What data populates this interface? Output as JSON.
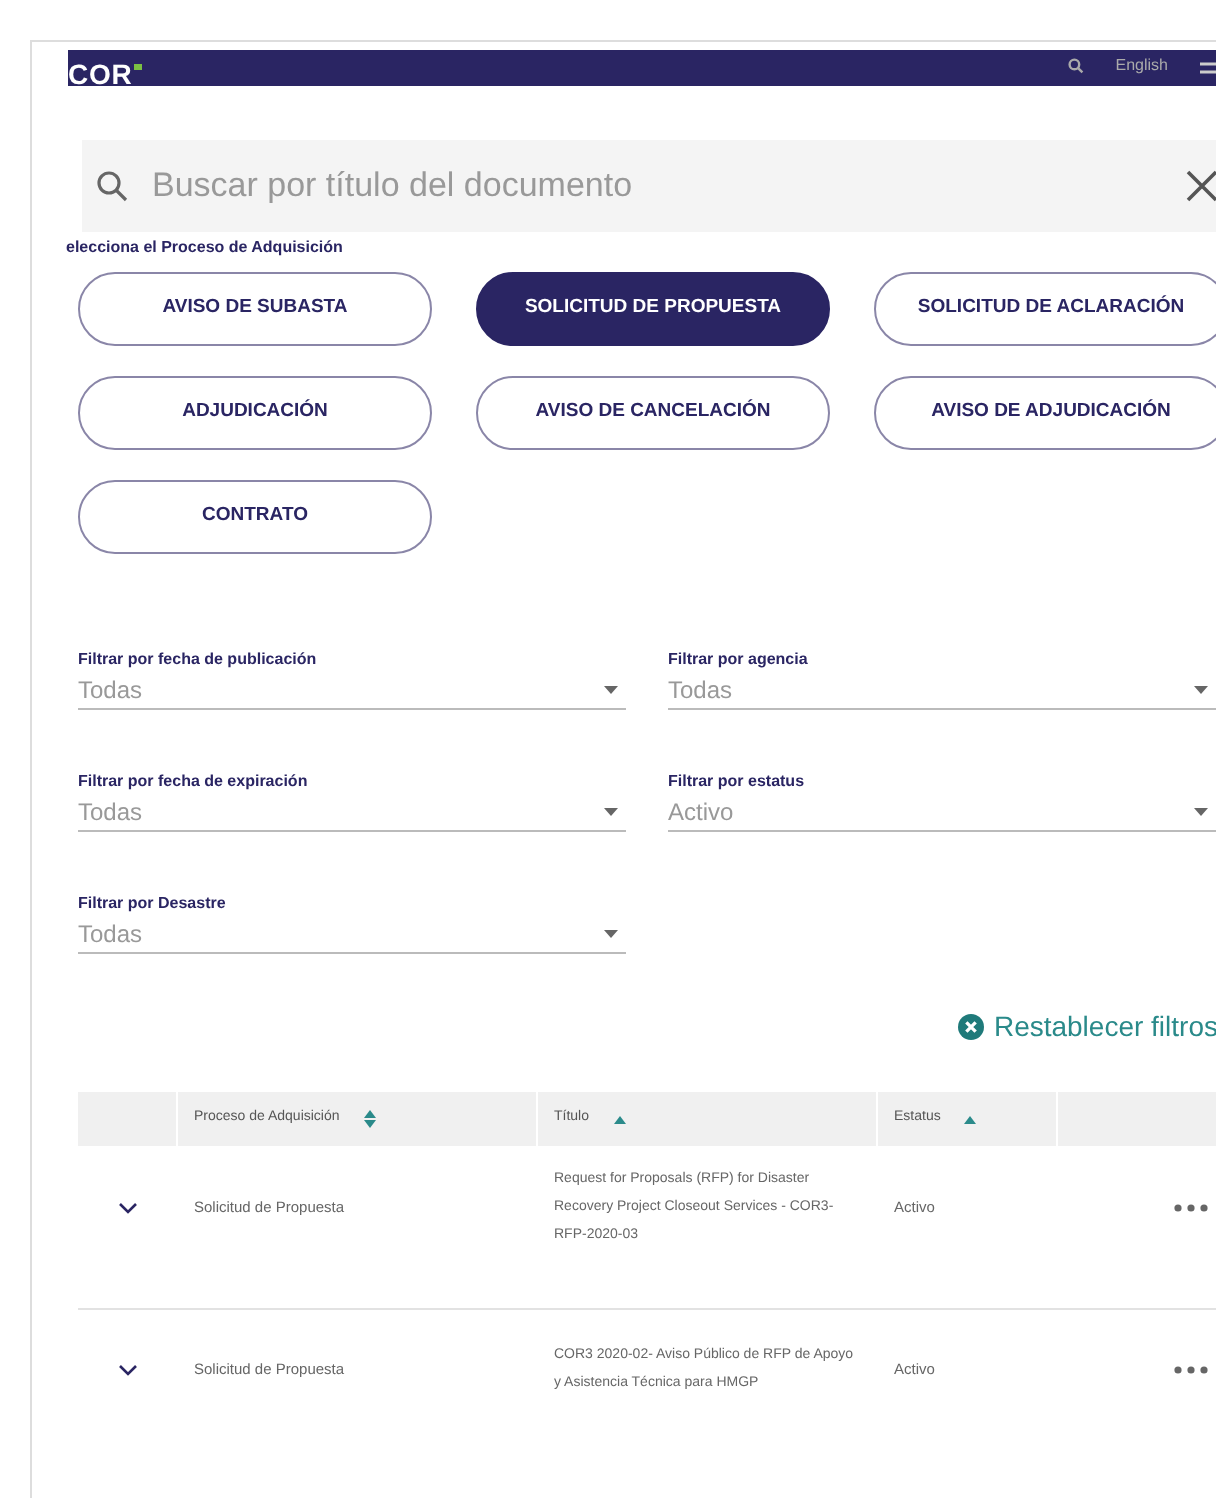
{
  "header": {
    "logo": "COR",
    "language": "English"
  },
  "search": {
    "placeholder": "Buscar por título del documento"
  },
  "process_label": "elecciona el Proceso de Adquisición",
  "process_buttons": [
    {
      "label": "AVISO DE SUBASTA",
      "selected": false
    },
    {
      "label": "SOLICITUD DE PROPUESTA",
      "selected": true
    },
    {
      "label": "SOLICITUD DE ACLARACIÓN",
      "selected": false
    },
    {
      "label": "ADJUDICACIÓN",
      "selected": false
    },
    {
      "label": "AVISO DE CANCELACIÓN",
      "selected": false
    },
    {
      "label": "AVISO DE ADJUDICACIÓN",
      "selected": false
    },
    {
      "label": "CONTRATO",
      "selected": false
    }
  ],
  "filters": [
    {
      "label": "Filtrar por fecha de publicación",
      "value": "Todas"
    },
    {
      "label": "Filtrar por agencia",
      "value": "Todas"
    },
    {
      "label": "Filtrar por fecha de expiración",
      "value": "Todas"
    },
    {
      "label": "Filtrar por estatus",
      "value": "Activo"
    },
    {
      "label": "Filtrar por Desastre",
      "value": "Todas"
    }
  ],
  "reset_button": "Restablecer filtros",
  "table": {
    "columns": [
      {
        "label": "Proceso de Adquisición",
        "sorted": false
      },
      {
        "label": "Título",
        "sorted": true
      },
      {
        "label": "Estatus",
        "sorted": true
      }
    ],
    "rows": [
      {
        "proceso": "Solicitud de Propuesta",
        "titulo": "Request for Proposals (RFP) for Disaster Recovery Project Closeout Services - COR3-RFP-2020-03",
        "estatus": "Activo"
      },
      {
        "proceso": "Solicitud de Propuesta",
        "titulo": "COR3 2020-02- Aviso Público de RFP de Apoyo y Asistencia Técnica para HMGP",
        "estatus": "Activo"
      }
    ]
  }
}
